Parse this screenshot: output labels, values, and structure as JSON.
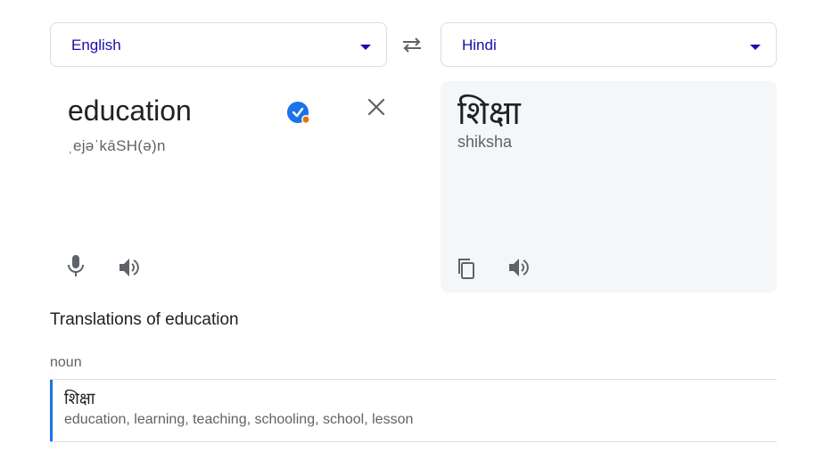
{
  "source_language": {
    "label": "English"
  },
  "target_language": {
    "label": "Hindi"
  },
  "source": {
    "word": "education",
    "phonetic": "ˌejəˈkāSH(ə)n"
  },
  "target": {
    "word": "शिक्षा",
    "transliteration": "shiksha"
  },
  "translations": {
    "title": "Translations of education",
    "part_of_speech": "noun",
    "entries": [
      {
        "word": "शिक्षा",
        "synonyms": "education, learning, teaching, schooling, school, lesson"
      }
    ]
  },
  "colors": {
    "accent": "#1a73e8",
    "link": "#1a0dab",
    "verified_badge": "#1a73e8",
    "badge_dot": "#e8710a"
  },
  "icons": [
    "chevron-down-icon",
    "swap-icon",
    "verified-icon",
    "close-icon",
    "microphone-icon",
    "speaker-icon",
    "copy-icon"
  ]
}
